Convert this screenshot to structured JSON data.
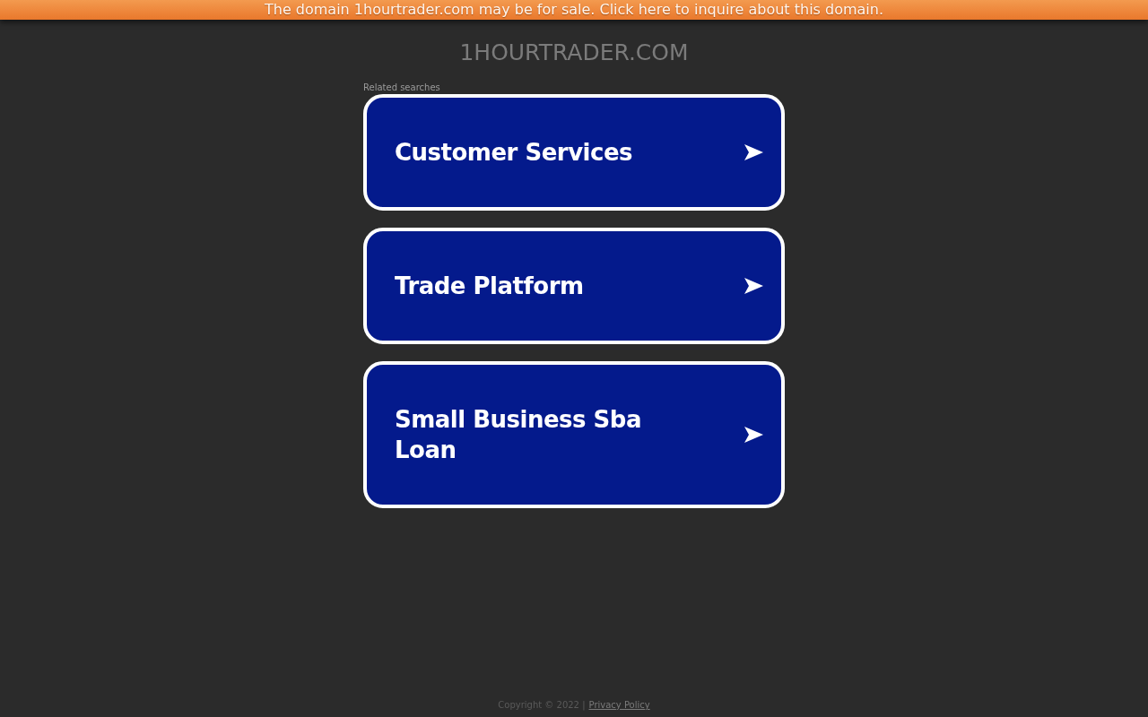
{
  "banner": {
    "text": "The domain 1hourtrader.com may be for sale. Click here to inquire about this domain."
  },
  "site_title": "1HOURTRADER.COM",
  "related_searches": {
    "heading": "Related searches",
    "items": [
      {
        "label": "Customer Services"
      },
      {
        "label": "Trade Platform"
      },
      {
        "label": "Small Business Sba Loan"
      }
    ]
  },
  "footer": {
    "copyright": "Copyright © 2022 |",
    "privacy_link": "Privacy Policy"
  }
}
